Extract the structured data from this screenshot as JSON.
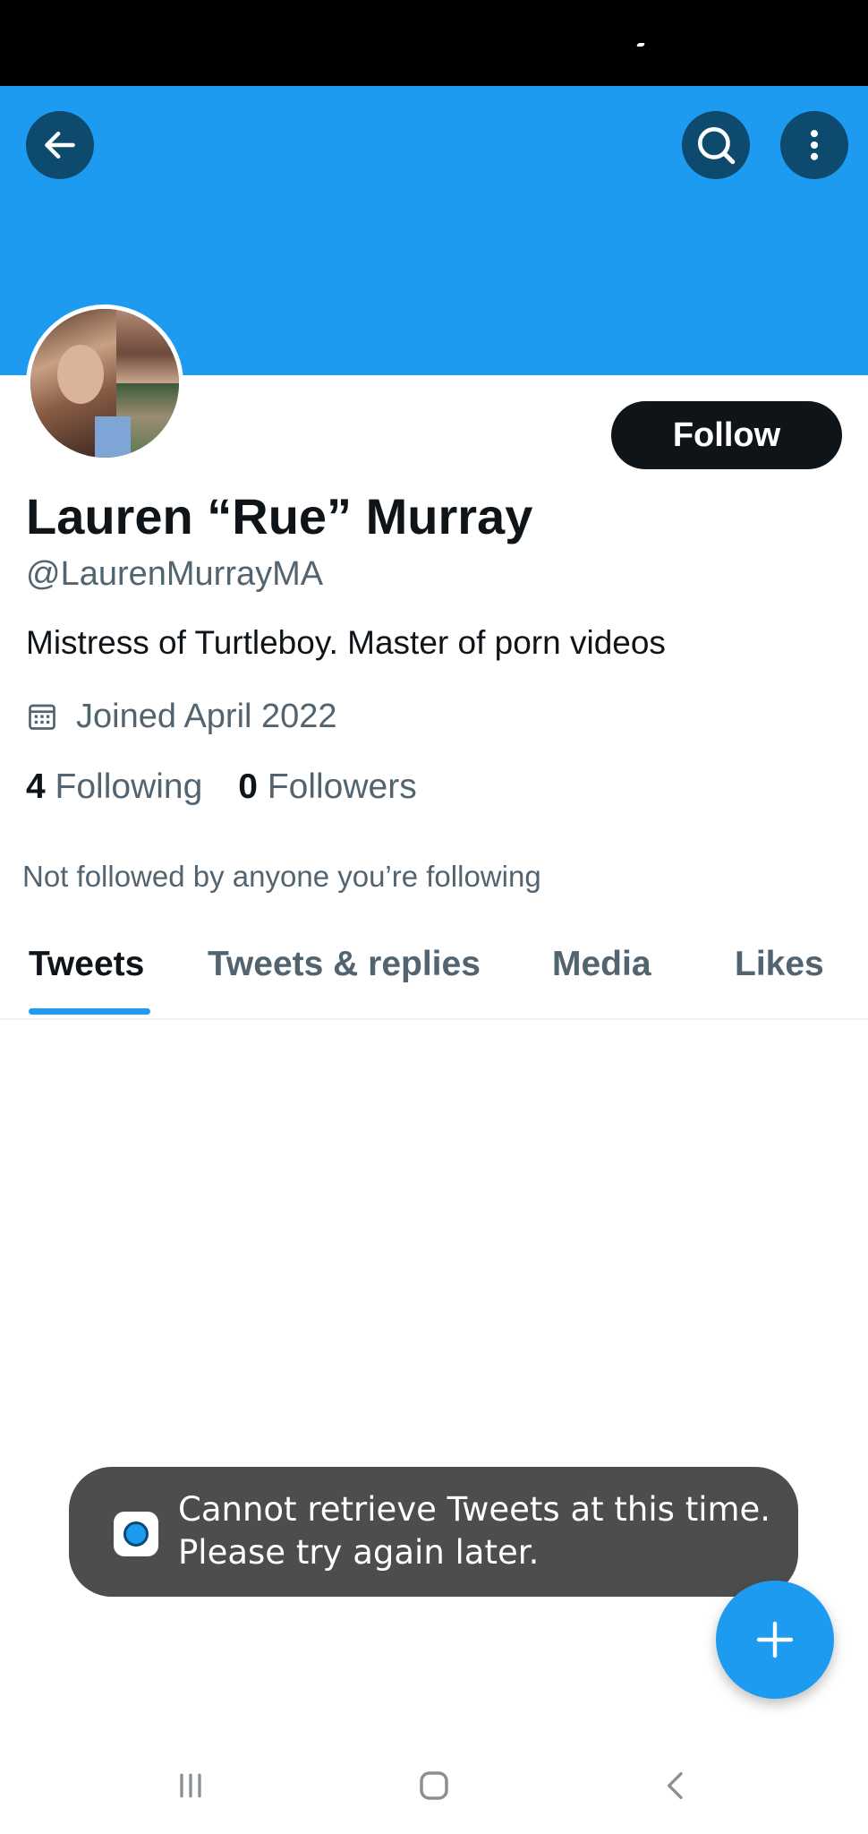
{
  "profile": {
    "name": "Lauren “Rue” Murray",
    "handle": "@LaurenMurrayMA",
    "bio": "Mistress of Turtleboy. Master of porn videos",
    "joined": "Joined April 2022",
    "following_count": "4",
    "following_label": "Following",
    "followers_count": "0",
    "followers_label": "Followers",
    "not_followed": "Not followed by anyone you’re following"
  },
  "actions": {
    "follow_label": "Follow"
  },
  "tabs": [
    {
      "label": "Tweets",
      "active": true
    },
    {
      "label": "Tweets & replies",
      "active": false
    },
    {
      "label": "Media",
      "active": false
    },
    {
      "label": "Likes",
      "active": false
    }
  ],
  "toast": {
    "line1": "Cannot retrieve Tweets at this time.",
    "line2": "Please try again later."
  },
  "colors": {
    "accent": "#1d9bf0",
    "dark": "#0f1419",
    "secondary_text": "#536471",
    "toast_bg": "#4d4d4d"
  },
  "icons": {
    "back": "arrow-left-icon",
    "search": "search-icon",
    "more": "more-vertical-icon",
    "calendar": "calendar-icon",
    "compose": "plus-icon",
    "recents": "recents-icon",
    "home": "home-icon",
    "nav_back": "chevron-left-icon"
  }
}
